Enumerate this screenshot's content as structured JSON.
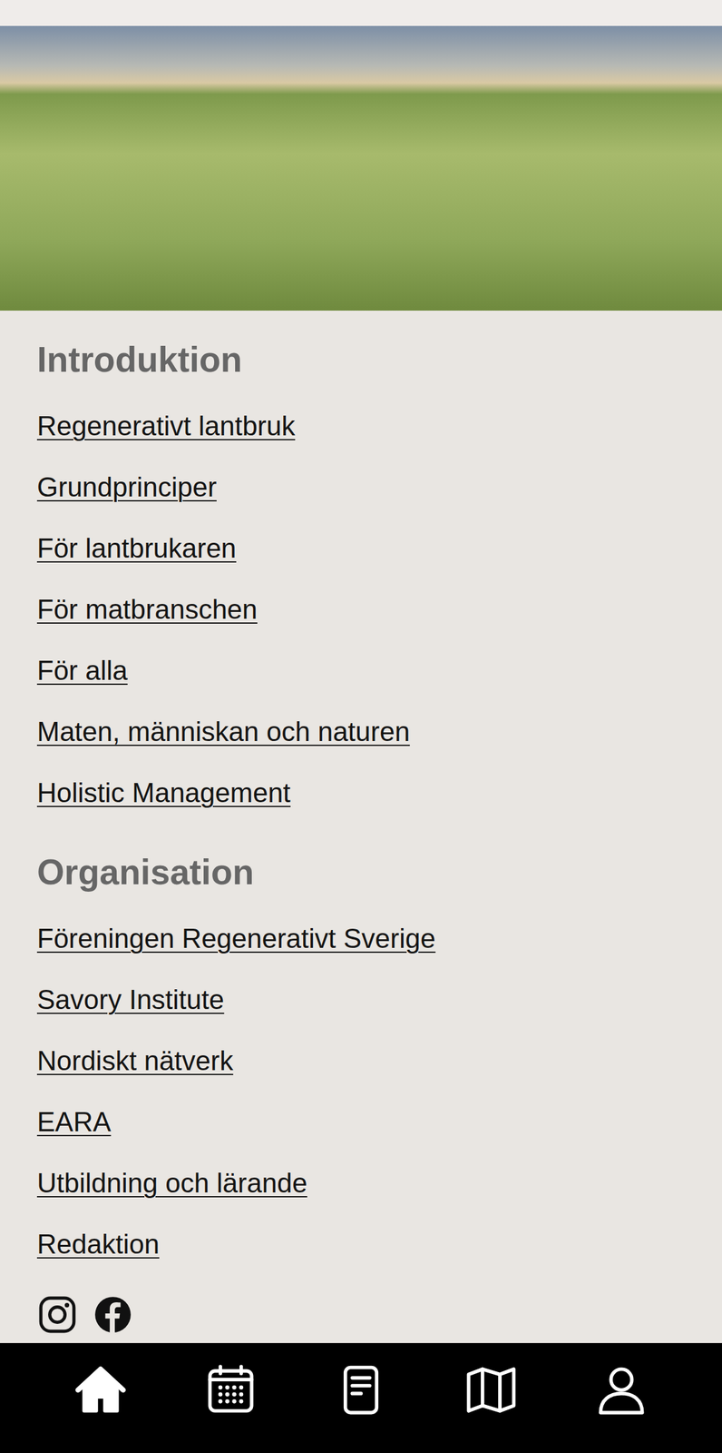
{
  "sections": [
    {
      "heading": "Introduktion",
      "links": [
        "Regenerativt lantbruk",
        "Grundprinciper",
        "För lantbrukaren",
        "För matbranschen",
        "För alla",
        "Maten, människan och naturen",
        "Holistic Management"
      ]
    },
    {
      "heading": "Organisation",
      "links": [
        "Föreningen Regenerativt Sverige",
        "Savory Institute",
        "Nordiskt nätverk",
        "EARA",
        "Utbildning och lärande",
        "Redaktion"
      ]
    }
  ],
  "social": [
    {
      "kind": "instagram"
    },
    {
      "kind": "facebook"
    }
  ],
  "nav": [
    {
      "kind": "home",
      "selected": true
    },
    {
      "kind": "calendar",
      "selected": false
    },
    {
      "kind": "document",
      "selected": false
    },
    {
      "kind": "map",
      "selected": false
    },
    {
      "kind": "user",
      "selected": false
    }
  ]
}
